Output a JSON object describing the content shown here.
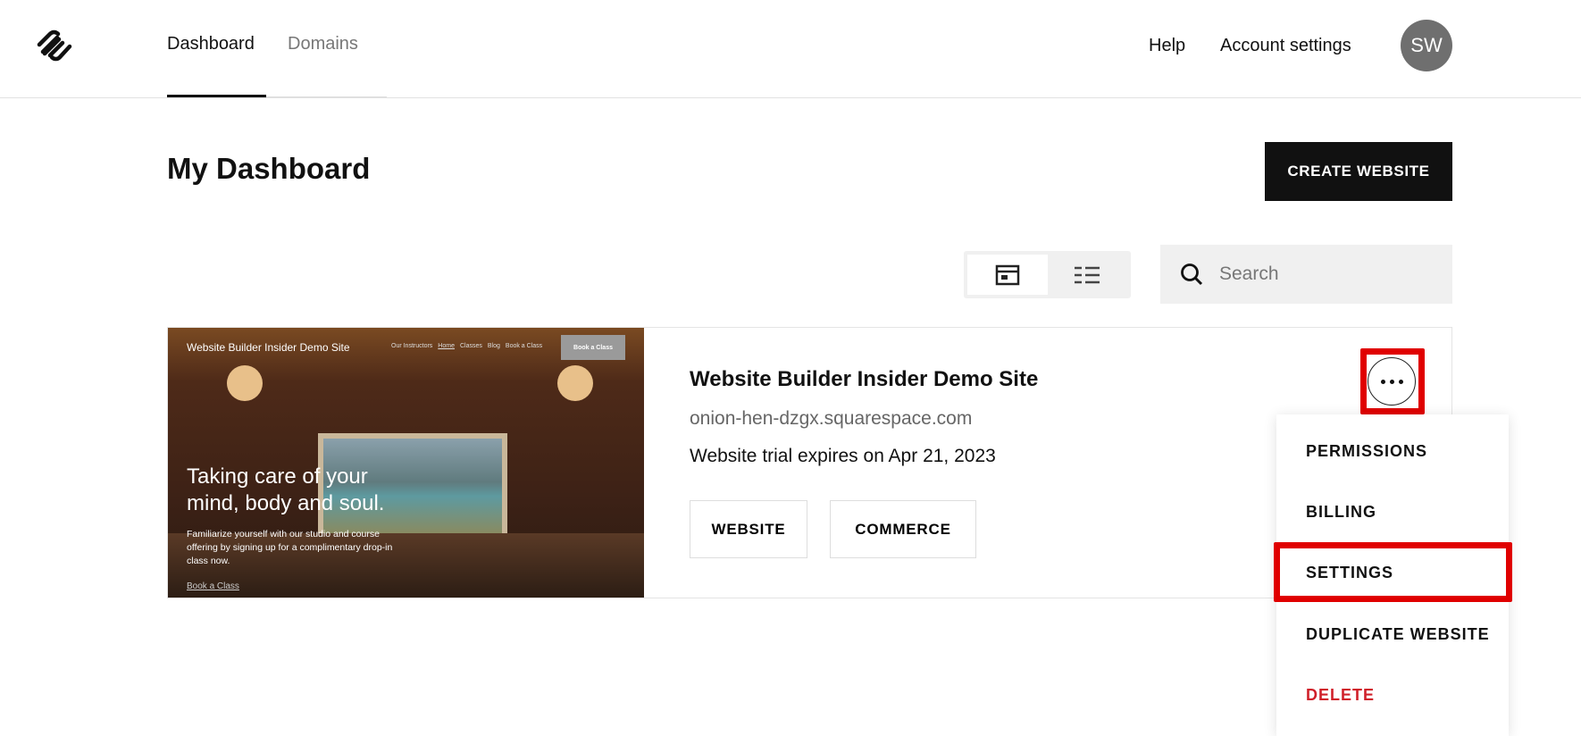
{
  "nav": {
    "tabs": [
      {
        "label": "Dashboard",
        "active": true
      },
      {
        "label": "Domains",
        "active": false
      }
    ],
    "help": "Help",
    "account_settings": "Account settings",
    "avatar_initials": "SW"
  },
  "page": {
    "title": "My Dashboard",
    "create_button": "CREATE WEBSITE",
    "search_placeholder": "Search"
  },
  "site": {
    "thumbnail": {
      "site_name": "Website Builder Insider Demo Site",
      "nav": [
        "Our Instructors",
        "Home",
        "Classes",
        "Blog",
        "Book a Class"
      ],
      "cta": "Book a Class",
      "headline": "Taking care of your mind, body and soul.",
      "body": "Familiarize yourself with our studio and course offering by signing up for a complimentary drop-in class now.",
      "link": "Book a Class"
    },
    "title": "Website Builder Insider Demo Site",
    "url": "onion-hen-dzgx.squarespace.com",
    "trial": "Website trial expires on Apr 21, 2023",
    "buttons": {
      "website": "WEBSITE",
      "commerce": "COMMERCE"
    }
  },
  "menu": {
    "items": [
      "PERMISSIONS",
      "BILLING",
      "SETTINGS",
      "DUPLICATE WEBSITE",
      "DELETE"
    ],
    "delete_color": "#d0202a"
  },
  "highlight_color": "#e00000"
}
